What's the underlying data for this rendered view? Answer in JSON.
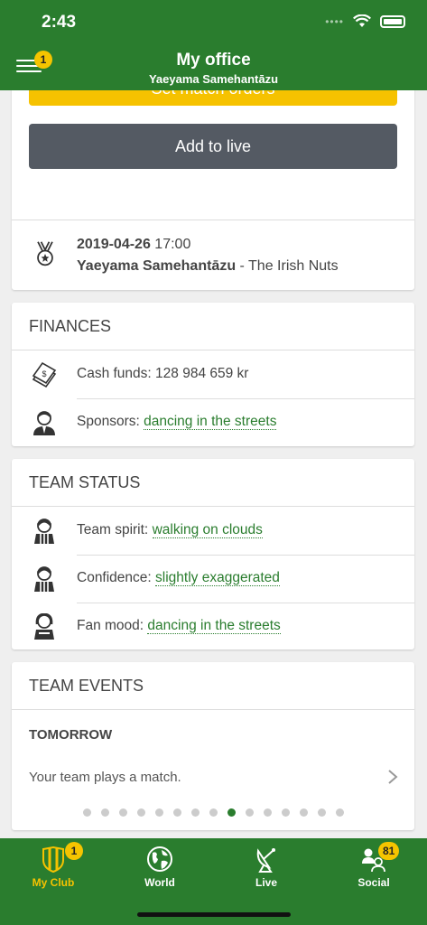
{
  "status_bar": {
    "time": "2:43"
  },
  "header": {
    "title": "My office",
    "subtitle": "Yaeyama Samehantāzu",
    "menu_badge": "1"
  },
  "actions": {
    "set_orders": "Set match orders",
    "add_live": "Add to live"
  },
  "match": {
    "date": "2019-04-26",
    "time": "17:00",
    "home": "Yaeyama Samehantāzu",
    "separator": "-",
    "away": "The Irish Nuts"
  },
  "finances": {
    "title": "FINANCES",
    "cash_label": "Cash funds:",
    "cash_value": "128 984 659 kr",
    "sponsors_label": "Sponsors:",
    "sponsors_value": "dancing in the streets"
  },
  "team_status": {
    "title": "TEAM STATUS",
    "items": [
      {
        "label": "Team spirit:",
        "value": "walking on clouds"
      },
      {
        "label": "Confidence:",
        "value": "slightly exaggerated"
      },
      {
        "label": "Fan mood:",
        "value": "dancing in the streets"
      }
    ]
  },
  "team_events": {
    "title": "TEAM EVENTS",
    "day": "TOMORROW",
    "text": "Your team plays a match.",
    "page_count": 15,
    "active_page": 9
  },
  "tabbar": {
    "items": [
      {
        "label": "My Club",
        "badge": "1",
        "icon": "shield-icon",
        "active": true
      },
      {
        "label": "World",
        "badge": "",
        "icon": "globe-icon",
        "active": false
      },
      {
        "label": "Live",
        "badge": "",
        "icon": "satellite-dish-icon",
        "active": false
      },
      {
        "label": "Social",
        "badge": "81",
        "icon": "people-icon",
        "active": false
      }
    ]
  },
  "colors": {
    "brand_green": "#2a7d2e",
    "accent_yellow": "#f6c200",
    "button_gray": "#545a63"
  }
}
